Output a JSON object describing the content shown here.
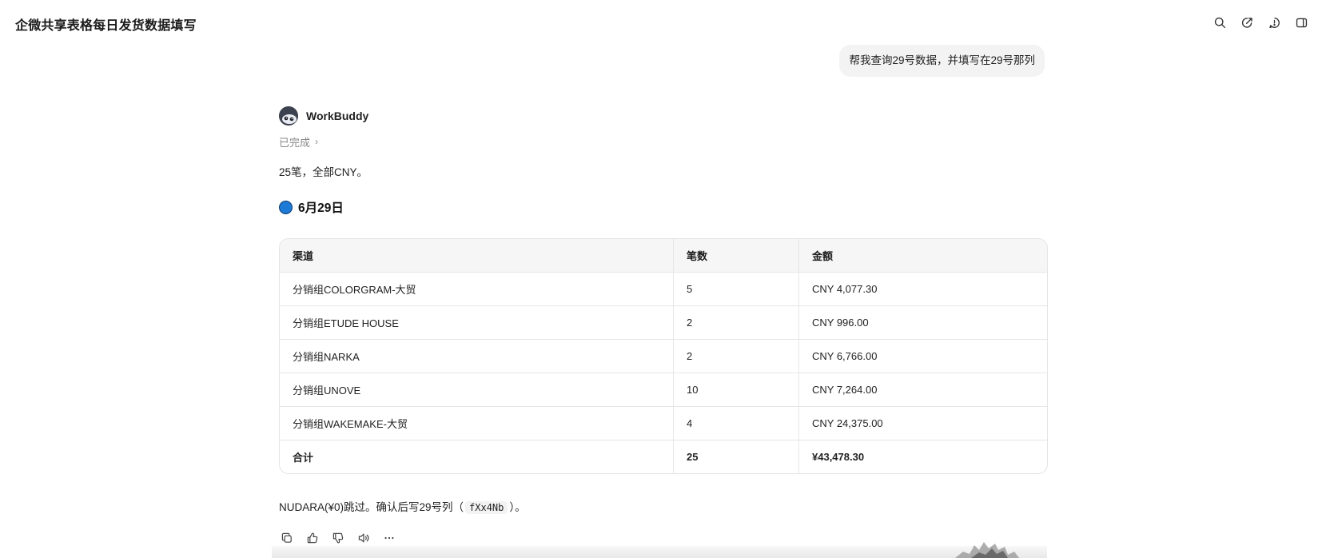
{
  "header": {
    "title": "企微共享表格每日发货数据填写"
  },
  "user_message": "帮我查询29号数据，并填写在29号那列",
  "assistant": {
    "name": "WorkBuddy",
    "status": "已完成",
    "summary": "25笔，全部CNY。",
    "section_title": "6月29日",
    "table": {
      "headers": [
        "渠道",
        "笔数",
        "金额"
      ],
      "rows": [
        [
          "分销组COLORGRAM-大贸",
          "5",
          "CNY 4,077.30"
        ],
        [
          "分销组ETUDE HOUSE",
          "2",
          "CNY 996.00"
        ],
        [
          "分销组NARKA",
          "2",
          "CNY 6,766.00"
        ],
        [
          "分销组UNOVE",
          "10",
          "CNY 7,264.00"
        ],
        [
          "分销组WAKEMAKE-大贸",
          "4",
          "CNY 24,375.00"
        ]
      ],
      "total": [
        "合计",
        "25",
        "¥43,478.30"
      ]
    },
    "note_prefix": "NUDARA(¥0)跳过。确认后写29号列（",
    "note_code": "fXx4Nb",
    "note_suffix": "）。"
  },
  "icons": {
    "header": [
      "search-icon",
      "new-chat-icon",
      "history-icon",
      "sidebar-toggle-icon"
    ],
    "actions": [
      "copy-icon",
      "thumbs-up-icon",
      "thumbs-down-icon",
      "read-aloud-icon",
      "more-icon"
    ]
  },
  "colors": {
    "accent_dot": "#1d7ad6",
    "bubble_bg": "#f3f3f3",
    "table_header_bg": "#f6f6f6"
  }
}
